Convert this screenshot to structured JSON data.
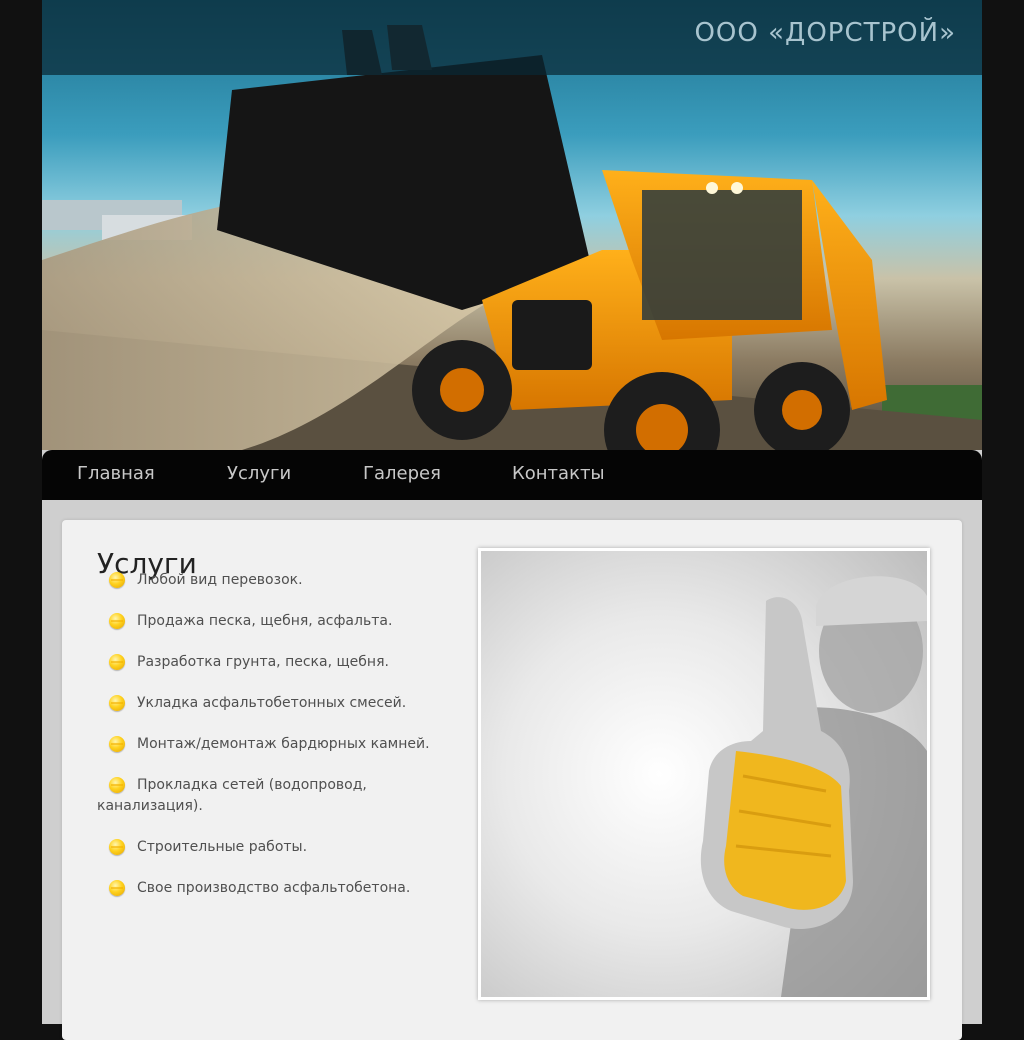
{
  "header": {
    "brand": "ООО «ДОРСТРОЙ»"
  },
  "nav": {
    "items": [
      {
        "label": "Главная"
      },
      {
        "label": "Услуги"
      },
      {
        "label": "Галерея"
      },
      {
        "label": "Контакты"
      }
    ]
  },
  "main": {
    "title": "Услуги",
    "services": [
      "Любой вид перевозок.",
      "Продажа песка, щебня, асфальта.",
      "Разработка грунта, песка, щебня.",
      "Укладка асфальтобетонных смесей.",
      "Монтаж/демонтаж бардюрных камней.",
      "Прокладка сетей (водопровод, канализация).",
      "Строительные работы.",
      "Свое производство асфальтобетона."
    ]
  },
  "colors": {
    "page_background": "#111111",
    "nav_background": "#050505",
    "brand_text": "#a8c4cf",
    "bullet": "#ffd21f"
  },
  "icons": {
    "bullet": "yellow-dot-icon"
  }
}
